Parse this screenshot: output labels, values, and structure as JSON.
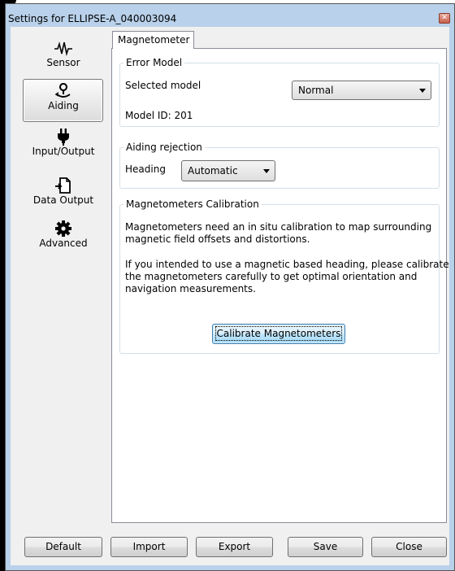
{
  "window": {
    "title": "Settings for ELLIPSE-A_040003094",
    "close_glyph": "✕"
  },
  "sidebar": {
    "items": [
      {
        "label": "Sensor",
        "icon": "waveform-icon",
        "selected": false
      },
      {
        "label": "Aiding",
        "icon": "location-pin-icon",
        "selected": true
      },
      {
        "label": "Input/Output",
        "icon": "plug-icon",
        "selected": false
      },
      {
        "label": "Data Output",
        "icon": "document-arrow-icon",
        "selected": false
      },
      {
        "label": "Advanced",
        "icon": "gear-icon",
        "selected": false
      }
    ]
  },
  "tabs": [
    {
      "label": "Magnetometer",
      "active": true
    }
  ],
  "error_model": {
    "title": "Error Model",
    "selected_model_label": "Selected model",
    "selected_model_value": "Normal",
    "model_id_text": "Model ID: 201"
  },
  "aiding_rejection": {
    "title": "Aiding rejection",
    "heading_label": "Heading",
    "heading_value": "Automatic"
  },
  "calibration": {
    "title": "Magnetometers Calibration",
    "para1_line1": "Magnetometers need an in situ calibration to map surrounding",
    "para1_line2": "magnetic field offsets and distortions.",
    "para2_line1": "If you intended to use a magnetic based heading, please calibrate",
    "para2_line2": "the magnetometers carefully to get optimal orientation and",
    "para2_line3": "navigation measurements.",
    "button_label": "Calibrate Magnetometers"
  },
  "footer": {
    "default_label": "Default",
    "import_label": "Import",
    "export_label": "Export",
    "save_label": "Save",
    "close_label": "Close"
  }
}
